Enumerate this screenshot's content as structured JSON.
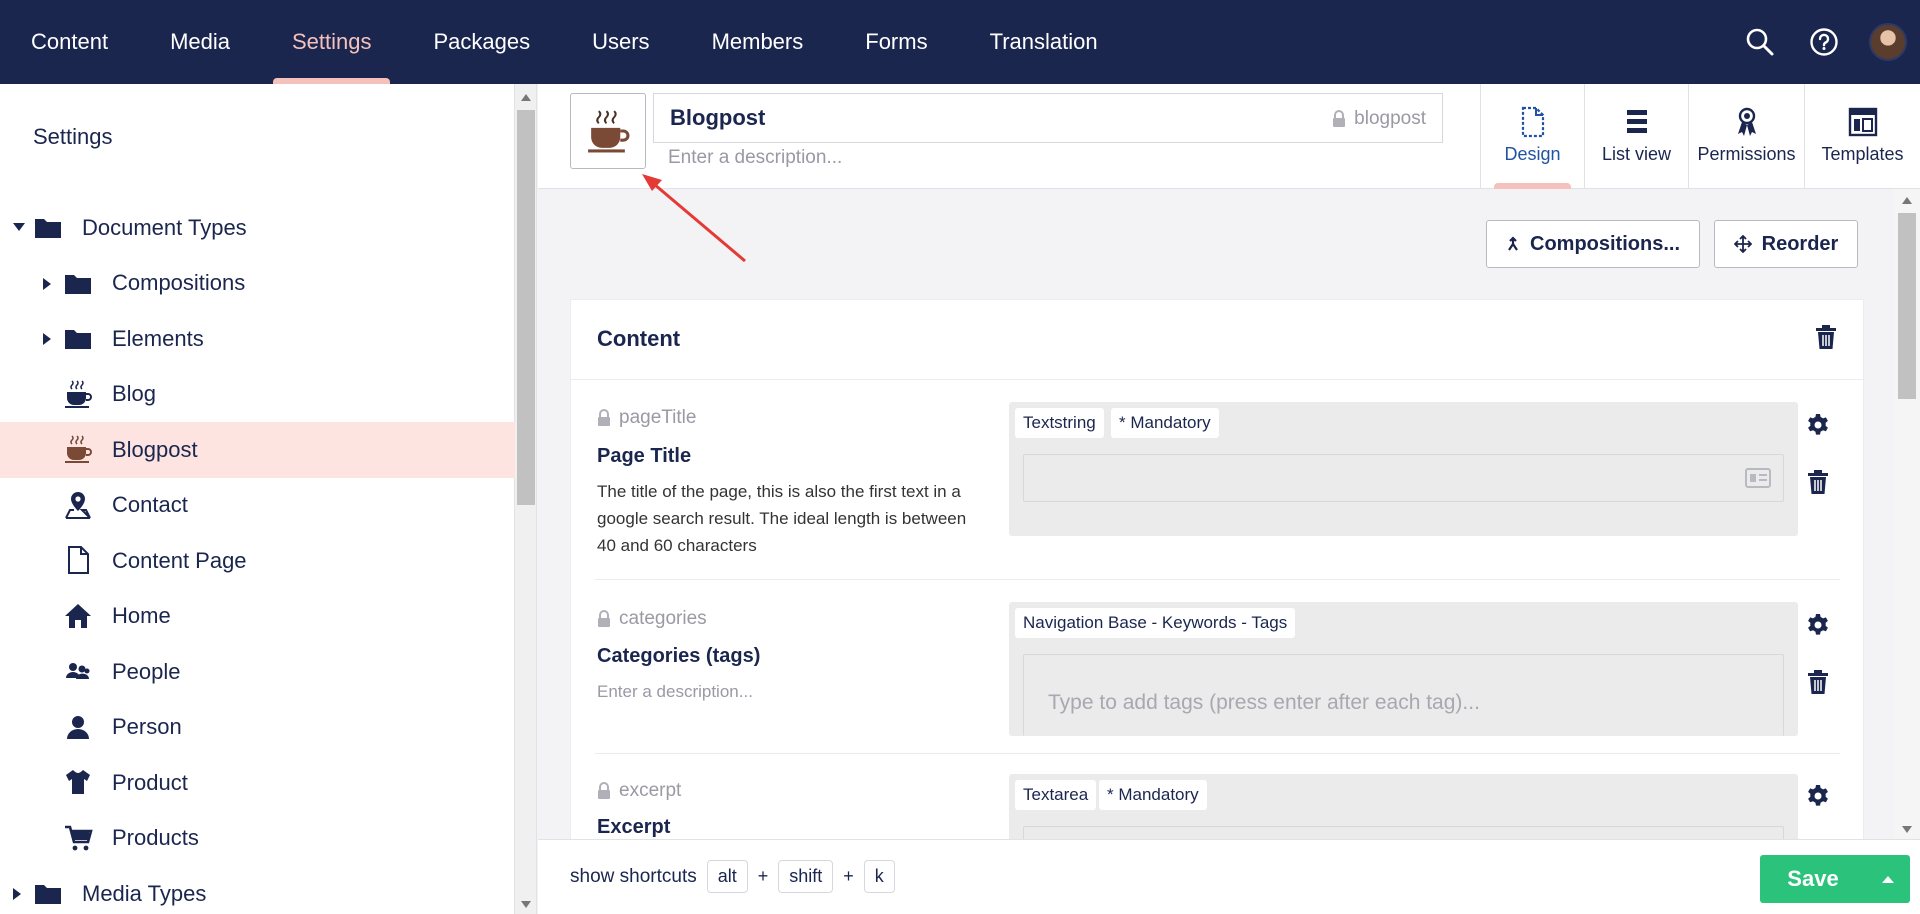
{
  "topnav": {
    "items": [
      "Content",
      "Media",
      "Settings",
      "Packages",
      "Users",
      "Members",
      "Forms",
      "Translation"
    ],
    "active_index": 2
  },
  "sidebar": {
    "title": "Settings",
    "tree": [
      {
        "label": "Document Types",
        "icon": "folder-icon",
        "caret": "down"
      },
      {
        "label": "Compositions",
        "icon": "folder-icon",
        "caret": "right"
      },
      {
        "label": "Elements",
        "icon": "folder-icon",
        "caret": "right"
      },
      {
        "label": "Blog",
        "icon": "coffee-icon"
      },
      {
        "label": "Blogpost",
        "icon": "coffee-icon",
        "selected": true
      },
      {
        "label": "Contact",
        "icon": "map-pin-icon"
      },
      {
        "label": "Content Page",
        "icon": "document-icon"
      },
      {
        "label": "Home",
        "icon": "home-icon"
      },
      {
        "label": "People",
        "icon": "users-icon"
      },
      {
        "label": "Person",
        "icon": "user-icon"
      },
      {
        "label": "Product",
        "icon": "shirt-icon"
      },
      {
        "label": "Products",
        "icon": "cart-icon"
      },
      {
        "label": "Media Types",
        "icon": "folder-icon",
        "caret": "right"
      }
    ]
  },
  "header": {
    "name": "Blogpost",
    "alias": "blogpost",
    "description_placeholder": "Enter a description...",
    "apps": [
      {
        "label": "Design",
        "icon": "document-icon",
        "active": true
      },
      {
        "label": "List view",
        "icon": "list-icon"
      },
      {
        "label": "Permissions",
        "icon": "ribbon-icon"
      },
      {
        "label": "Templates",
        "icon": "layout-icon"
      }
    ]
  },
  "toolbar": {
    "compositions_label": "Compositions...",
    "reorder_label": "Reorder"
  },
  "group": {
    "title": "Content",
    "properties": [
      {
        "alias": "pageTitle",
        "label": "Page Title",
        "description": "The title of the page, this is also the first text in a google search result. The ideal length is between 40 and 60 characters",
        "tags": [
          "Textstring",
          "* Mandatory"
        ]
      },
      {
        "alias": "categories",
        "label": "Categories (tags)",
        "description": "Enter a description...",
        "tags": [
          "Navigation Base - Keywords - Tags"
        ],
        "input_placeholder": "Type to add tags (press enter after each tag)..."
      },
      {
        "alias": "excerpt",
        "label": "Excerpt",
        "tags": [
          "Textarea",
          "* Mandatory"
        ]
      }
    ]
  },
  "footer": {
    "shortcuts_label": "show shortcuts",
    "keys": [
      "alt",
      "+",
      "shift",
      "+",
      "k"
    ],
    "save_label": "Save"
  },
  "colors": {
    "nav_bg": "#1b264f",
    "accent_pink": "#f5c1bc",
    "selected_bg": "#fde4e1",
    "save_green": "#2bc37c",
    "annotation_red": "#e53935"
  }
}
